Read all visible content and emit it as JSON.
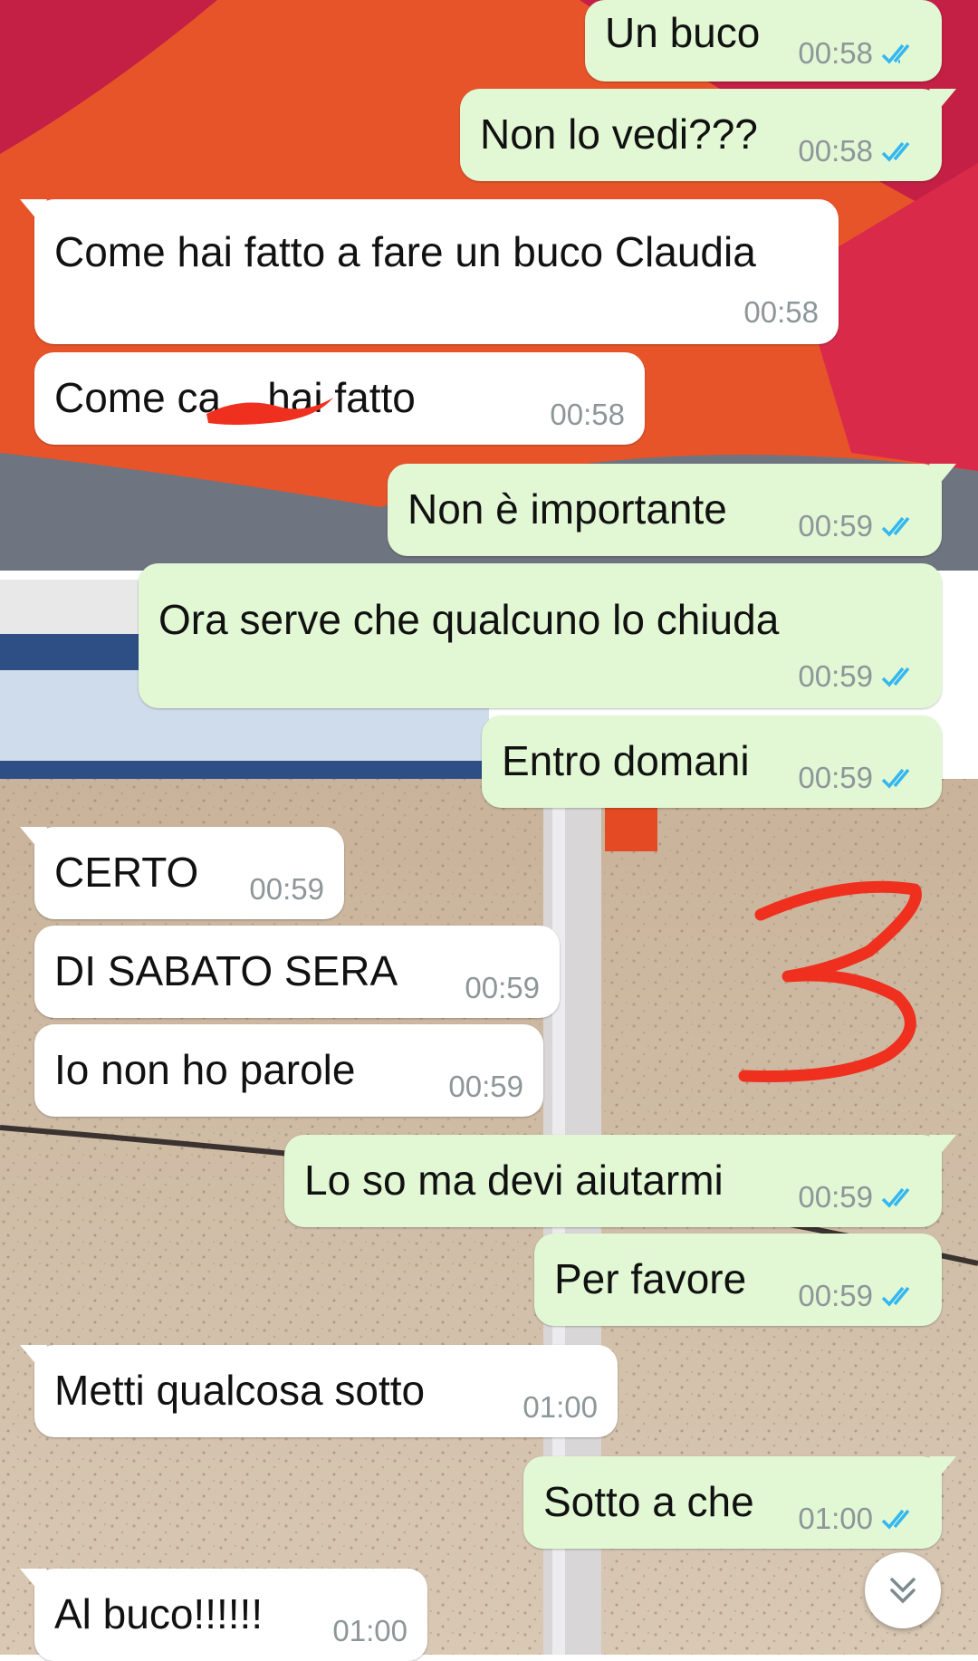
{
  "colors": {
    "outgoing_bubble": "#e2f8d4",
    "incoming_bubble": "#ffffff",
    "read_ticks": "#34b7f1",
    "timestamp": "#8d9699",
    "annotation": "#f0301e"
  },
  "messages": [
    {
      "direction": "out",
      "text": "Un buco",
      "time": "00:58",
      "status": "read"
    },
    {
      "direction": "out",
      "text": "Non lo vedi???",
      "time": "00:58",
      "status": "read"
    },
    {
      "direction": "in",
      "text": "Come hai fatto a fare un buco Claudia",
      "time": "00:58"
    },
    {
      "direction": "in",
      "text": "Come ca    hai fatto",
      "time": "00:58",
      "redacted": true
    },
    {
      "direction": "out",
      "text": "Non è importante",
      "time": "00:59",
      "status": "read"
    },
    {
      "direction": "out",
      "text": "Ora serve che qualcuno lo chiuda",
      "time": "00:59",
      "status": "read"
    },
    {
      "direction": "out",
      "text": "Entro domani",
      "time": "00:59",
      "status": "read"
    },
    {
      "direction": "in",
      "text": "CERTO",
      "time": "00:59"
    },
    {
      "direction": "in",
      "text": "DI SABATO SERA",
      "time": "00:59"
    },
    {
      "direction": "in",
      "text": "Io non ho parole",
      "time": "00:59"
    },
    {
      "direction": "out",
      "text": "Lo so ma devi aiutarmi",
      "time": "00:59",
      "status": "read"
    },
    {
      "direction": "out",
      "text": "Per favore",
      "time": "00:59",
      "status": "read"
    },
    {
      "direction": "in",
      "text": "Metti qualcosa sotto",
      "time": "01:00"
    },
    {
      "direction": "out",
      "text": "Sotto a che",
      "time": "01:00",
      "status": "read"
    },
    {
      "direction": "in",
      "text": "Al buco!!!!!!",
      "time": "01:00"
    }
  ],
  "annotation": {
    "text": "3"
  },
  "scroll_button": {
    "icon": "double-chevron-down-icon"
  }
}
